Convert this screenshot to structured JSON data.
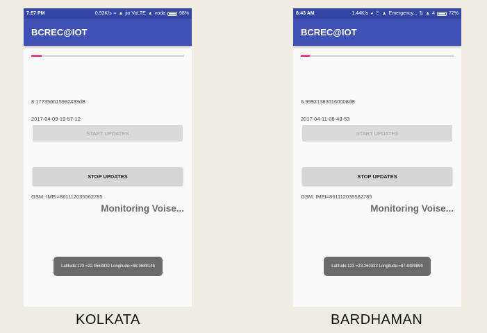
{
  "phones": [
    {
      "status": {
        "time": "7:57 PM",
        "speed": "0.93K/s",
        "carrier1": "jio VoLTE",
        "carrier2": "voda",
        "battery": "98%"
      },
      "app_title": "BCREC@IOT",
      "progress_fraction": 0.07,
      "db_reading": "8.177356615982433dB",
      "timestamp": "2017-04-09-19-57-12",
      "start_button": "START UPDATES",
      "stop_button": "STOP UPDATES",
      "imei": "GSM: IMEI=861112035562785",
      "monitoring": "Monitoring Voise...",
      "toast": "Latitude:123 =22.4563832 Longitude:=88.3688148"
    },
    {
      "status": {
        "time": "8:43 AM",
        "speed": "1.44K/s",
        "carrier1": "Emergency...",
        "carrier2": "4",
        "battery": "72%"
      },
      "app_title": "BCREC@IOT",
      "progress_fraction": 0.06,
      "db_reading": "6.999213830160008dB",
      "timestamp": "2017-04-11-08-43-53",
      "start_button": "START UPDATES",
      "stop_button": "STOP UPDATES",
      "imei": "GSM: IMEI=861112035562785",
      "monitoring": "Monitoring Voise...",
      "toast": "Latitude:123 =23.260333 Longitude:=87.8489899"
    }
  ],
  "captions": [
    "KOLKATA",
    "BARDHAMAN"
  ],
  "colors": {
    "app_bar": "#3f51b5",
    "status_bar": "#3446a3",
    "progress": "#e8407a"
  }
}
